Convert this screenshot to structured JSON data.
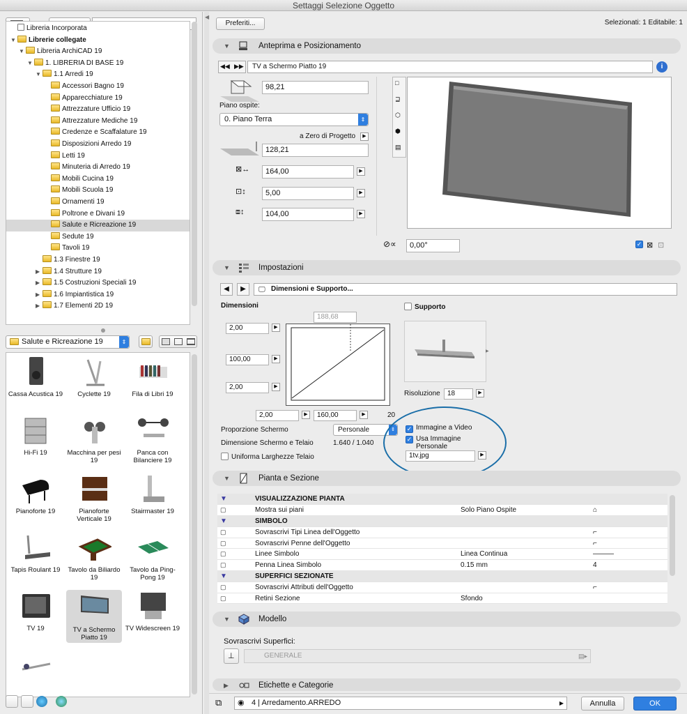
{
  "window": {
    "title": "Settaggi Selezione Oggetto"
  },
  "left": {
    "tree": [
      {
        "label": "Libreria Incorporata",
        "indent": 0,
        "arrow": "",
        "folder": false
      },
      {
        "label": "Librerie collegate",
        "indent": 0,
        "arrow": "▼",
        "folder": true,
        "bold": true
      },
      {
        "label": "Libreria ArchiCAD 19",
        "indent": 1,
        "arrow": "▼",
        "folder": true
      },
      {
        "label": "1. LIBRERIA DI BASE 19",
        "indent": 2,
        "arrow": "▼",
        "folder": true
      },
      {
        "label": "1.1 Arredi 19",
        "indent": 3,
        "arrow": "▼",
        "folder": true
      },
      {
        "label": "Accessori Bagno 19",
        "indent": 4,
        "arrow": "",
        "folder": true
      },
      {
        "label": "Apparecchiature 19",
        "indent": 4,
        "arrow": "",
        "folder": true
      },
      {
        "label": "Attrezzature Ufficio 19",
        "indent": 4,
        "arrow": "",
        "folder": true
      },
      {
        "label": "Attrezzature Mediche 19",
        "indent": 4,
        "arrow": "",
        "folder": true
      },
      {
        "label": "Credenze e Scaffalature 19",
        "indent": 4,
        "arrow": "",
        "folder": true
      },
      {
        "label": "Disposizioni Arredo 19",
        "indent": 4,
        "arrow": "",
        "folder": true
      },
      {
        "label": "Letti 19",
        "indent": 4,
        "arrow": "",
        "folder": true
      },
      {
        "label": "Minuteria di Arredo 19",
        "indent": 4,
        "arrow": "",
        "folder": true
      },
      {
        "label": "Mobili Cucina 19",
        "indent": 4,
        "arrow": "",
        "folder": true
      },
      {
        "label": "Mobili Scuola 19",
        "indent": 4,
        "arrow": "",
        "folder": true
      },
      {
        "label": "Ornamenti 19",
        "indent": 4,
        "arrow": "",
        "folder": true
      },
      {
        "label": "Poltrone e Divani 19",
        "indent": 4,
        "arrow": "",
        "folder": true
      },
      {
        "label": "Salute e Ricreazione 19",
        "indent": 4,
        "arrow": "",
        "folder": true,
        "selected": true
      },
      {
        "label": "Sedute 19",
        "indent": 4,
        "arrow": "",
        "folder": true
      },
      {
        "label": "Tavoli 19",
        "indent": 4,
        "arrow": "",
        "folder": true
      },
      {
        "label": "1.3 Finestre 19",
        "indent": 3,
        "arrow": "",
        "folder": true
      },
      {
        "label": "1.4 Strutture 19",
        "indent": 3,
        "arrow": "▶",
        "folder": true
      },
      {
        "label": "1.5 Costruzioni Speciali 19",
        "indent": 3,
        "arrow": "▶",
        "folder": true
      },
      {
        "label": "1.6 Impiantistica 19",
        "indent": 3,
        "arrow": "▶",
        "folder": true
      },
      {
        "label": "1.7 Elementi 2D 19",
        "indent": 3,
        "arrow": "▶",
        "folder": true
      }
    ],
    "folder_select": "Salute e Ricreazione 19",
    "objects": [
      {
        "label": "Cassa Acustica 19",
        "icon": "speaker-icon"
      },
      {
        "label": "Cyclette 19",
        "icon": "exercise-bike-icon"
      },
      {
        "label": "Fila di Libri 19",
        "icon": "books-icon"
      },
      {
        "label": "Hi-Fi 19",
        "icon": "hifi-icon"
      },
      {
        "label": "Macchina per pesi 19",
        "icon": "weight-machine-icon"
      },
      {
        "label": "Panca con Bilanciere 19",
        "icon": "bench-press-icon"
      },
      {
        "label": "Pianoforte 19",
        "icon": "grand-piano-icon"
      },
      {
        "label": "Pianoforte Verticale 19",
        "icon": "upright-piano-icon"
      },
      {
        "label": "Stairmaster 19",
        "icon": "stairmaster-icon"
      },
      {
        "label": "Tapis Roulant 19",
        "icon": "treadmill-icon"
      },
      {
        "label": "Tavolo da Biliardo 19",
        "icon": "billiard-table-icon"
      },
      {
        "label": "Tavolo da Ping-Pong 19",
        "icon": "pingpong-table-icon"
      },
      {
        "label": "TV 19",
        "icon": "tv-icon"
      },
      {
        "label": "TV a Schermo Piatto 19",
        "icon": "flat-tv-icon",
        "selected": true
      },
      {
        "label": "TV Widescreen 19",
        "icon": "widescreen-tv-icon"
      },
      {
        "label": "",
        "icon": "rowing-machine-icon"
      }
    ]
  },
  "top": {
    "preferiti": "Preferiti...",
    "selection_info": "Selezionati: 1 Editabile: 1"
  },
  "anteprima": {
    "title": "Anteprima e Posizionamento",
    "object_name": "TV a Schermo Piatto 19",
    "height": "98,21",
    "piano_label": "Piano ospite:",
    "piano_value": "0. Piano Terra",
    "zero_label": "a Zero di Progetto",
    "elevation": "128,21",
    "x": "164,00",
    "y": "5,00",
    "z": "104,00",
    "angle": "0,00°"
  },
  "impostazioni": {
    "title": "Impostazioni",
    "page": "Dimensioni e Supporto...",
    "dimensioni_label": "Dimensioni",
    "width_top": "188,68",
    "left_top": "2,00",
    "left_mid": "100,00",
    "left_bot": "2,00",
    "bottom_left": "2,00",
    "bottom_mid": "160,00",
    "bottom_right": "20",
    "supporto_label": "Supporto",
    "risoluzione_label": "Risoluzione",
    "risoluzione_value": "18",
    "proporzione_label": "Proporzione Schermo",
    "proporzione_value": "Personale",
    "dim_telaio_label": "Dimensione Schermo e Telaio",
    "dim_telaio_value": "1.640 / 1.040",
    "uniforma_label": "Uniforma Larghezze Telaio",
    "immagine_label": "Immagine a Video",
    "usa_label": "Usa Immagine Personale",
    "file_value": "1tv.jpg"
  },
  "pianta": {
    "title": "Pianta e Sezione",
    "rows": [
      {
        "type": "header",
        "name": "VISUALIZZAZIONE PIANTA"
      },
      {
        "type": "row",
        "name": "Mostra sui piani",
        "value": "Solo Piano Ospite",
        "extra": "⌂"
      },
      {
        "type": "header",
        "name": "SIMBOLO"
      },
      {
        "type": "row",
        "name": "Sovrascrivi Tipi Linea dell'Oggetto",
        "value": "",
        "extra": "⌐"
      },
      {
        "type": "row",
        "name": "Sovrascrivi Penne dell'Oggetto",
        "value": "",
        "extra": "⌐"
      },
      {
        "type": "row",
        "name": "Linee Simbolo",
        "value": "Linea Continua",
        "extra": "———"
      },
      {
        "type": "row",
        "name": "Penna Linea Simbolo",
        "value": "0.15 mm",
        "extra": "4"
      },
      {
        "type": "header",
        "name": "SUPERFICI SEZIONATE"
      },
      {
        "type": "row",
        "name": "Sovrascrivi Attributi dell'Oggetto",
        "value": "",
        "extra": "⌐"
      },
      {
        "type": "row",
        "name": "Retini Sezione",
        "value": "Sfondo",
        "extra": ""
      }
    ]
  },
  "modello": {
    "title": "Modello",
    "sovr_label": "Sovrascrivi Superfici:",
    "surface": "GENERALE"
  },
  "etichette": {
    "title": "Etichette e Categorie"
  },
  "bottom": {
    "layer": "4 | Arredamento.ARREDO",
    "cancel": "Annulla",
    "ok": "OK"
  },
  "colors": {
    "ok": "#2f7fe0",
    "highlight": "#1a6ea8",
    "select": "#2f7fe0"
  }
}
